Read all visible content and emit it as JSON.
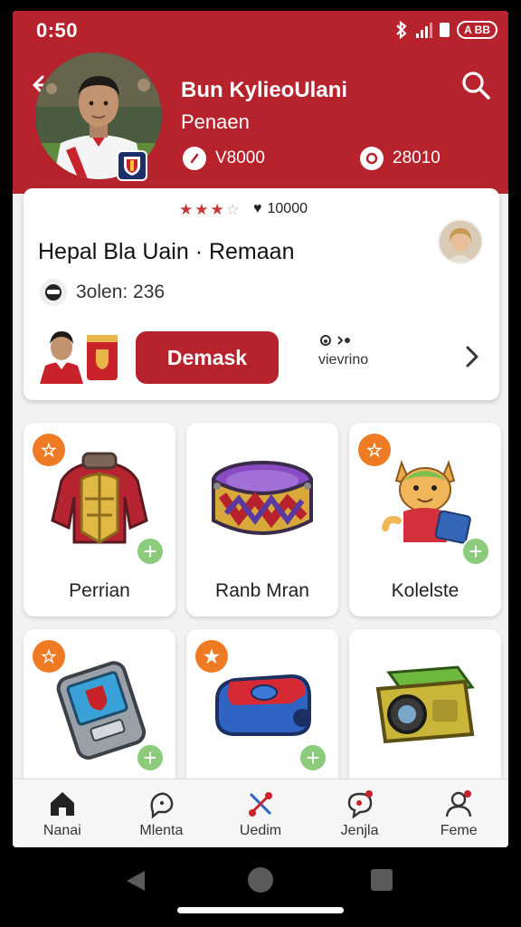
{
  "status_bar": {
    "time": "0:50",
    "battery_label": "A BB"
  },
  "header": {
    "title": "Bun KylieoUlani",
    "subtitle": "Penaen",
    "stat_a": "V8000",
    "stat_b": "28010"
  },
  "profile_card": {
    "rating_stars": 3,
    "rating_max": 4,
    "fans_count": "10000",
    "title": "Hepal Bla Uain · Remaan",
    "score": "3olen: 236",
    "primary_button": "Demask",
    "viewing_label": "vievrino"
  },
  "tiles": [
    {
      "label": "Perrian",
      "has_badge": true,
      "badge_glyph": "☆",
      "has_plus": true
    },
    {
      "label": "Ranb Mran",
      "has_badge": false,
      "has_plus": false
    },
    {
      "label": "Kolelste",
      "has_badge": true,
      "badge_glyph": "☆",
      "has_plus": true
    },
    {
      "label": "",
      "has_badge": true,
      "badge_glyph": "☆",
      "has_plus": true
    },
    {
      "label": "",
      "has_badge": true,
      "badge_glyph": "★",
      "has_plus": true
    },
    {
      "label": "",
      "has_badge": false,
      "has_plus": false
    }
  ],
  "bottom_nav": [
    {
      "label": "Nanai",
      "icon": "home-icon"
    },
    {
      "label": "Mlenta",
      "icon": "chat-icon"
    },
    {
      "label": "Uedim",
      "icon": "crossed-tools-icon"
    },
    {
      "label": "Jenjla",
      "icon": "message-icon"
    },
    {
      "label": "Feme",
      "icon": "profile-icon"
    }
  ],
  "colors": {
    "brand_red": "#b7232d",
    "badge_orange": "#ee7a24",
    "plus_green": "#8ccb7c"
  }
}
